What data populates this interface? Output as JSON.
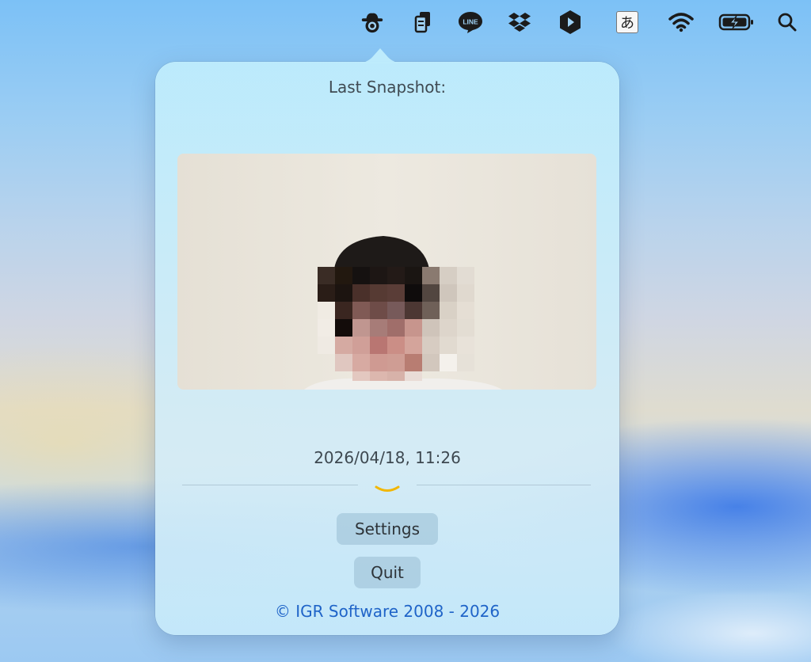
{
  "menubar": {
    "items": [
      {
        "icon": "spy-hat-icon"
      },
      {
        "icon": "clipboard-icon"
      },
      {
        "icon": "line-app-icon",
        "label": "LINE"
      },
      {
        "icon": "dropbox-icon"
      },
      {
        "icon": "shortcut-play-icon"
      },
      {
        "icon": "input-method-icon",
        "label": "あ"
      },
      {
        "icon": "wifi-icon"
      },
      {
        "icon": "battery-charging-icon"
      },
      {
        "icon": "search-icon"
      }
    ]
  },
  "popover": {
    "title": "Last Snapshot:",
    "timestamp": "2026/04/18, 11:26",
    "settings_label": "Settings",
    "quit_label": "Quit",
    "copyright": "© IGR Software 2008 - 2026"
  },
  "colors": {
    "accent": "#1f64c8",
    "chevron": "#f2b705"
  }
}
